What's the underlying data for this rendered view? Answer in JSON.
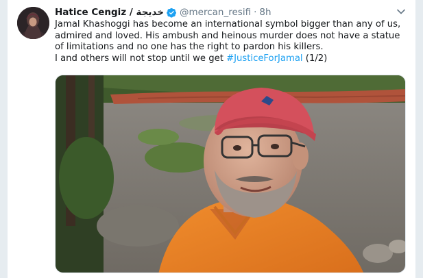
{
  "tweet": {
    "author_name": "Hatice Cengiz / خديجة",
    "handle": "@mercan_resifi",
    "separator": "·",
    "time": "8h",
    "text_line1": "Jamal Khashoggi has become an international symbol bigger than any of us, admired and loved. His ambush and heinous murder does not have a statue of limitations and no one has the right to pardon his killers.",
    "text_line2_prefix": "I and others will not stop until we get ",
    "hashtag": "#JusticeForJamal",
    "text_line2_suffix": " (1/2)"
  },
  "icons": {
    "verified": "verified-badge-icon",
    "menu": "chevron-down-icon"
  },
  "colors": {
    "link": "#1da1f2",
    "secondary_text": "#657786",
    "verified": "#1da1f2",
    "shirt": "#e8822a",
    "cap": "#d6525c"
  }
}
